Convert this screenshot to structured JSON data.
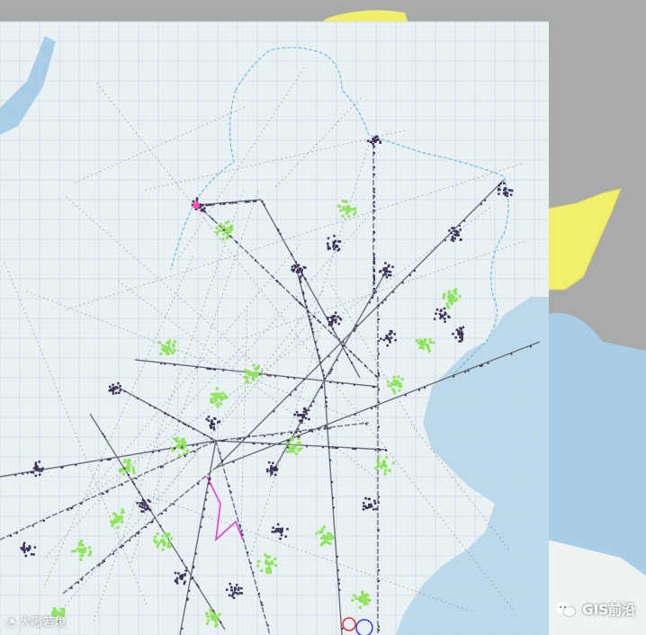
{
  "map": {
    "colors": {
      "paper": "#eaf1f4",
      "grid": "#c5d3dc",
      "sea": "#a8cde6",
      "land_outside": "#a9abaa",
      "neighbour": "#f2ef6b",
      "route": "#6b6e78",
      "airport": "#3d3459",
      "green_marker": "#8ee45a",
      "magenta_route": "#e040d0",
      "border": "#6cc0d6"
    },
    "icons": [
      "wechat-icon",
      "camera-watermark-icon"
    ]
  },
  "watermarks": {
    "left": "大嗷若境",
    "right": "GIS前沿",
    "ghost": "Dieldake"
  }
}
